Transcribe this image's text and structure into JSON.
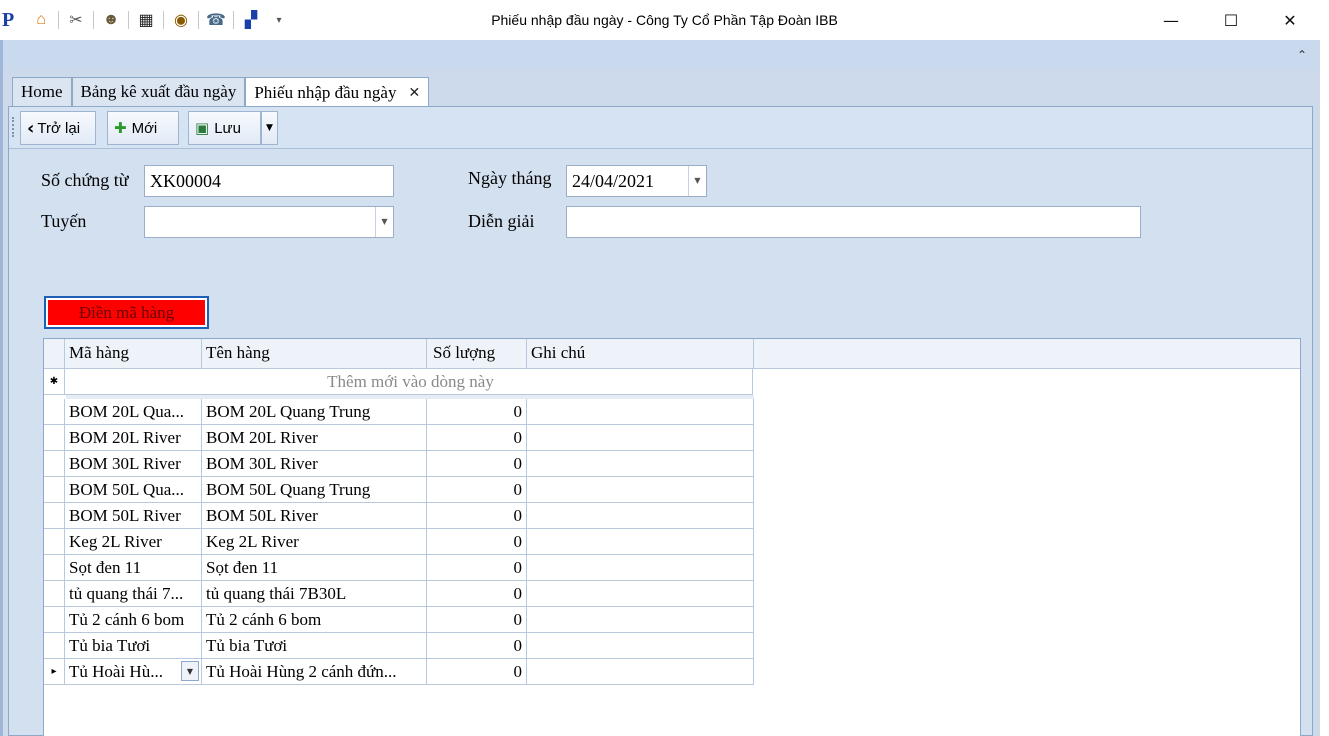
{
  "titlebar": {
    "title": "Phiếu nhập đầu ngày - Công Ty Cổ Phần Tập Đoàn IBB",
    "app_logo": "P",
    "qat_icons": [
      "home-icon",
      "scissors-icon",
      "users-icon",
      "film-icon",
      "eye-icon",
      "phone-icon",
      "puzzle-icon",
      "customize-dropdown-icon"
    ],
    "minimize": "—",
    "maximize": "☐",
    "close": "✕"
  },
  "ribbon": {
    "collapse_glyph": "⌃"
  },
  "tabs": [
    {
      "label": "Home"
    },
    {
      "label": "Bảng kê xuất đầu ngày"
    },
    {
      "label": "Phiếu nhập đầu ngày",
      "active": true,
      "close": "✕"
    }
  ],
  "toolbar": {
    "back_label": "Trở lại",
    "new_label": "Mới",
    "save_label": "Lưu"
  },
  "form": {
    "voucher_no_label": "Số chứng từ",
    "voucher_no_value": "XK00004",
    "date_label": "Ngày tháng",
    "date_value": "24/04/2021",
    "route_label": "Tuyến",
    "route_value": "",
    "description_label": "Diễn giải",
    "description_value": ""
  },
  "fill_button": {
    "label": "Điền mã hàng",
    "color": "#ff0000"
  },
  "grid": {
    "columns": [
      "Mã hàng",
      "Tên hàng",
      "Số lượng",
      "Ghi chú"
    ],
    "new_row_marker": "✱",
    "new_row_text": "Thêm mới vào dòng này",
    "current_row_marker": "▸",
    "rows": [
      {
        "code": "BOM 20L Qua...",
        "name": "BOM 20L Quang Trung",
        "qty": "0",
        "note": ""
      },
      {
        "code": "BOM 20L River",
        "name": "BOM 20L River",
        "qty": "0",
        "note": ""
      },
      {
        "code": "BOM 30L River",
        "name": "BOM 30L River",
        "qty": "0",
        "note": ""
      },
      {
        "code": "BOM 50L Qua...",
        "name": "BOM 50L Quang Trung",
        "qty": "0",
        "note": ""
      },
      {
        "code": "BOM 50L River",
        "name": "BOM 50L River",
        "qty": "0",
        "note": ""
      },
      {
        "code": "Keg 2L River",
        "name": "Keg 2L River",
        "qty": "0",
        "note": ""
      },
      {
        "code": "Sọt đen 11",
        "name": "Sọt đen 11",
        "qty": "0",
        "note": ""
      },
      {
        "code": "tủ  quang thái 7...",
        "name": "tủ  quang thái 7B30L",
        "qty": "0",
        "note": ""
      },
      {
        "code": "Tủ 2 cánh 6 bom",
        "name": "Tủ 2 cánh 6 bom",
        "qty": "0",
        "note": ""
      },
      {
        "code": "Tủ bia Tươi",
        "name": "Tủ bia Tươi",
        "qty": "0",
        "note": ""
      },
      {
        "code": "Tủ Hoài Hù...",
        "name": "Tủ Hoài Hùng 2 cánh đứn...",
        "qty": "0",
        "note": "",
        "current": true
      }
    ]
  }
}
